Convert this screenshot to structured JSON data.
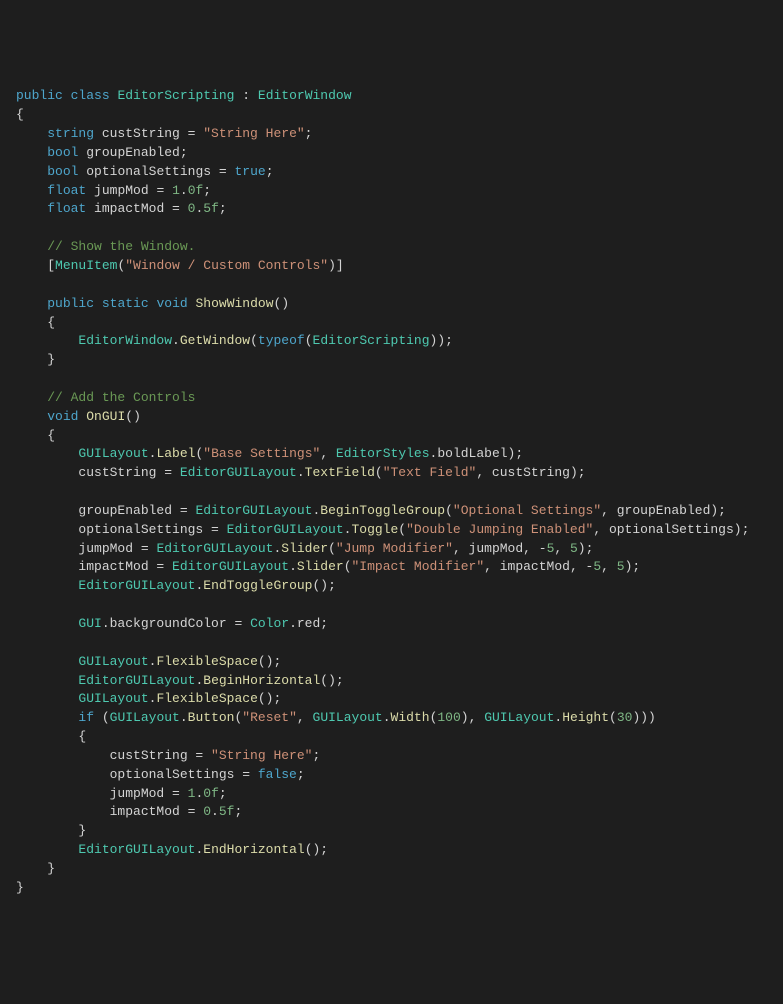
{
  "tokens": [
    [
      {
        "t": "public",
        "c": "kw"
      },
      {
        "t": " ",
        "c": "punct"
      },
      {
        "t": "class",
        "c": "kw"
      },
      {
        "t": " ",
        "c": "punct"
      },
      {
        "t": "EditorScripting",
        "c": "classname"
      },
      {
        "t": " : ",
        "c": "punct"
      },
      {
        "t": "EditorWindow",
        "c": "classname"
      }
    ],
    [
      {
        "t": "{",
        "c": "punct"
      }
    ],
    [
      {
        "t": "    ",
        "c": "punct"
      },
      {
        "t": "string",
        "c": "kw"
      },
      {
        "t": " custString = ",
        "c": "ident"
      },
      {
        "t": "\"String Here\"",
        "c": "str"
      },
      {
        "t": ";",
        "c": "punct"
      }
    ],
    [
      {
        "t": "    ",
        "c": "punct"
      },
      {
        "t": "bool",
        "c": "kw"
      },
      {
        "t": " groupEnabled;",
        "c": "ident"
      }
    ],
    [
      {
        "t": "    ",
        "c": "punct"
      },
      {
        "t": "bool",
        "c": "kw"
      },
      {
        "t": " optionalSettings = ",
        "c": "ident"
      },
      {
        "t": "true",
        "c": "kw"
      },
      {
        "t": ";",
        "c": "punct"
      }
    ],
    [
      {
        "t": "    ",
        "c": "punct"
      },
      {
        "t": "float",
        "c": "kw"
      },
      {
        "t": " jumpMod = ",
        "c": "ident"
      },
      {
        "t": "1",
        "c": "num"
      },
      {
        "t": ".",
        "c": "punct"
      },
      {
        "t": "0f",
        "c": "num"
      },
      {
        "t": ";",
        "c": "punct"
      }
    ],
    [
      {
        "t": "    ",
        "c": "punct"
      },
      {
        "t": "float",
        "c": "kw"
      },
      {
        "t": " impactMod = ",
        "c": "ident"
      },
      {
        "t": "0",
        "c": "num"
      },
      {
        "t": ".",
        "c": "punct"
      },
      {
        "t": "5f",
        "c": "num"
      },
      {
        "t": ";",
        "c": "punct"
      }
    ],
    [
      {
        "t": " ",
        "c": "punct"
      }
    ],
    [
      {
        "t": "    ",
        "c": "punct"
      },
      {
        "t": "// Show the Window.",
        "c": "comment"
      }
    ],
    [
      {
        "t": "    [",
        "c": "punct"
      },
      {
        "t": "MenuItem",
        "c": "attr"
      },
      {
        "t": "(",
        "c": "punct"
      },
      {
        "t": "\"Window / Custom Controls\"",
        "c": "str"
      },
      {
        "t": ")]",
        "c": "punct"
      }
    ],
    [
      {
        "t": " ",
        "c": "punct"
      }
    ],
    [
      {
        "t": "    ",
        "c": "punct"
      },
      {
        "t": "public",
        "c": "kw"
      },
      {
        "t": " ",
        "c": "punct"
      },
      {
        "t": "static",
        "c": "kw"
      },
      {
        "t": " ",
        "c": "punct"
      },
      {
        "t": "void",
        "c": "kw"
      },
      {
        "t": " ",
        "c": "punct"
      },
      {
        "t": "ShowWindow",
        "c": "method"
      },
      {
        "t": "()",
        "c": "punct"
      }
    ],
    [
      {
        "t": "    {",
        "c": "punct"
      }
    ],
    [
      {
        "t": "        ",
        "c": "punct"
      },
      {
        "t": "EditorWindow",
        "c": "classname"
      },
      {
        "t": ".",
        "c": "punct"
      },
      {
        "t": "GetWindow",
        "c": "method"
      },
      {
        "t": "(",
        "c": "punct"
      },
      {
        "t": "typeof",
        "c": "kw"
      },
      {
        "t": "(",
        "c": "punct"
      },
      {
        "t": "EditorScripting",
        "c": "classname"
      },
      {
        "t": "));",
        "c": "punct"
      }
    ],
    [
      {
        "t": "    }",
        "c": "punct"
      }
    ],
    [
      {
        "t": " ",
        "c": "punct"
      }
    ],
    [
      {
        "t": "    ",
        "c": "punct"
      },
      {
        "t": "// Add the Controls",
        "c": "comment"
      }
    ],
    [
      {
        "t": "    ",
        "c": "punct"
      },
      {
        "t": "void",
        "c": "kw"
      },
      {
        "t": " ",
        "c": "punct"
      },
      {
        "t": "OnGUI",
        "c": "method"
      },
      {
        "t": "()",
        "c": "punct"
      }
    ],
    [
      {
        "t": "    {",
        "c": "punct"
      }
    ],
    [
      {
        "t": "        ",
        "c": "punct"
      },
      {
        "t": "GUILayout",
        "c": "classname"
      },
      {
        "t": ".",
        "c": "punct"
      },
      {
        "t": "Label",
        "c": "method"
      },
      {
        "t": "(",
        "c": "punct"
      },
      {
        "t": "\"Base Settings\"",
        "c": "str"
      },
      {
        "t": ", ",
        "c": "punct"
      },
      {
        "t": "EditorStyles",
        "c": "classname"
      },
      {
        "t": ".boldLabel);",
        "c": "ident"
      }
    ],
    [
      {
        "t": "        custString = ",
        "c": "ident"
      },
      {
        "t": "EditorGUILayout",
        "c": "classname"
      },
      {
        "t": ".",
        "c": "punct"
      },
      {
        "t": "TextField",
        "c": "method"
      },
      {
        "t": "(",
        "c": "punct"
      },
      {
        "t": "\"Text Field\"",
        "c": "str"
      },
      {
        "t": ", custString);",
        "c": "ident"
      }
    ],
    [
      {
        "t": " ",
        "c": "punct"
      }
    ],
    [
      {
        "t": "        groupEnabled = ",
        "c": "ident"
      },
      {
        "t": "EditorGUILayout",
        "c": "classname"
      },
      {
        "t": ".",
        "c": "punct"
      },
      {
        "t": "BeginToggleGroup",
        "c": "method"
      },
      {
        "t": "(",
        "c": "punct"
      },
      {
        "t": "\"Optional Settings\"",
        "c": "str"
      },
      {
        "t": ", groupEnabled);",
        "c": "ident"
      }
    ],
    [
      {
        "t": "        optionalSettings = ",
        "c": "ident"
      },
      {
        "t": "EditorGUILayout",
        "c": "classname"
      },
      {
        "t": ".",
        "c": "punct"
      },
      {
        "t": "Toggle",
        "c": "method"
      },
      {
        "t": "(",
        "c": "punct"
      },
      {
        "t": "\"Double Jumping Enabled\"",
        "c": "str"
      },
      {
        "t": ", optionalSettings);",
        "c": "ident"
      }
    ],
    [
      {
        "t": "        jumpMod = ",
        "c": "ident"
      },
      {
        "t": "EditorGUILayout",
        "c": "classname"
      },
      {
        "t": ".",
        "c": "punct"
      },
      {
        "t": "Slider",
        "c": "method"
      },
      {
        "t": "(",
        "c": "punct"
      },
      {
        "t": "\"Jump Modifier\"",
        "c": "str"
      },
      {
        "t": ", jumpMod, -",
        "c": "ident"
      },
      {
        "t": "5",
        "c": "num"
      },
      {
        "t": ", ",
        "c": "punct"
      },
      {
        "t": "5",
        "c": "num"
      },
      {
        "t": ");",
        "c": "punct"
      }
    ],
    [
      {
        "t": "        impactMod = ",
        "c": "ident"
      },
      {
        "t": "EditorGUILayout",
        "c": "classname"
      },
      {
        "t": ".",
        "c": "punct"
      },
      {
        "t": "Slider",
        "c": "method"
      },
      {
        "t": "(",
        "c": "punct"
      },
      {
        "t": "\"Impact Modifier\"",
        "c": "str"
      },
      {
        "t": ", impactMod, -",
        "c": "ident"
      },
      {
        "t": "5",
        "c": "num"
      },
      {
        "t": ", ",
        "c": "punct"
      },
      {
        "t": "5",
        "c": "num"
      },
      {
        "t": ");",
        "c": "punct"
      }
    ],
    [
      {
        "t": "        ",
        "c": "punct"
      },
      {
        "t": "EditorGUILayout",
        "c": "classname"
      },
      {
        "t": ".",
        "c": "punct"
      },
      {
        "t": "EndToggleGroup",
        "c": "method"
      },
      {
        "t": "();",
        "c": "punct"
      }
    ],
    [
      {
        "t": " ",
        "c": "punct"
      }
    ],
    [
      {
        "t": "        ",
        "c": "punct"
      },
      {
        "t": "GUI",
        "c": "classname"
      },
      {
        "t": ".backgroundColor = ",
        "c": "ident"
      },
      {
        "t": "Color",
        "c": "classname"
      },
      {
        "t": ".red;",
        "c": "ident"
      }
    ],
    [
      {
        "t": " ",
        "c": "punct"
      }
    ],
    [
      {
        "t": "        ",
        "c": "punct"
      },
      {
        "t": "GUILayout",
        "c": "classname"
      },
      {
        "t": ".",
        "c": "punct"
      },
      {
        "t": "FlexibleSpace",
        "c": "method"
      },
      {
        "t": "();",
        "c": "punct"
      }
    ],
    [
      {
        "t": "        ",
        "c": "punct"
      },
      {
        "t": "EditorGUILayout",
        "c": "classname"
      },
      {
        "t": ".",
        "c": "punct"
      },
      {
        "t": "BeginHorizontal",
        "c": "method"
      },
      {
        "t": "();",
        "c": "punct"
      }
    ],
    [
      {
        "t": "        ",
        "c": "punct"
      },
      {
        "t": "GUILayout",
        "c": "classname"
      },
      {
        "t": ".",
        "c": "punct"
      },
      {
        "t": "FlexibleSpace",
        "c": "method"
      },
      {
        "t": "();",
        "c": "punct"
      }
    ],
    [
      {
        "t": "        ",
        "c": "punct"
      },
      {
        "t": "if",
        "c": "kw"
      },
      {
        "t": " (",
        "c": "punct"
      },
      {
        "t": "GUILayout",
        "c": "classname"
      },
      {
        "t": ".",
        "c": "punct"
      },
      {
        "t": "Button",
        "c": "method"
      },
      {
        "t": "(",
        "c": "punct"
      },
      {
        "t": "\"Reset\"",
        "c": "str"
      },
      {
        "t": ", ",
        "c": "punct"
      },
      {
        "t": "GUILayout",
        "c": "classname"
      },
      {
        "t": ".",
        "c": "punct"
      },
      {
        "t": "Width",
        "c": "method"
      },
      {
        "t": "(",
        "c": "punct"
      },
      {
        "t": "100",
        "c": "num"
      },
      {
        "t": "), ",
        "c": "punct"
      },
      {
        "t": "GUILayout",
        "c": "classname"
      },
      {
        "t": ".",
        "c": "punct"
      },
      {
        "t": "Height",
        "c": "method"
      },
      {
        "t": "(",
        "c": "punct"
      },
      {
        "t": "30",
        "c": "num"
      },
      {
        "t": ")))",
        "c": "punct"
      }
    ],
    [
      {
        "t": "        {",
        "c": "punct"
      }
    ],
    [
      {
        "t": "            custString = ",
        "c": "ident"
      },
      {
        "t": "\"String Here\"",
        "c": "str"
      },
      {
        "t": ";",
        "c": "punct"
      }
    ],
    [
      {
        "t": "            optionalSettings = ",
        "c": "ident"
      },
      {
        "t": "false",
        "c": "kw"
      },
      {
        "t": ";",
        "c": "punct"
      }
    ],
    [
      {
        "t": "            jumpMod = ",
        "c": "ident"
      },
      {
        "t": "1",
        "c": "num"
      },
      {
        "t": ".",
        "c": "punct"
      },
      {
        "t": "0f",
        "c": "num"
      },
      {
        "t": ";",
        "c": "punct"
      }
    ],
    [
      {
        "t": "            impactMod = ",
        "c": "ident"
      },
      {
        "t": "0",
        "c": "num"
      },
      {
        "t": ".",
        "c": "punct"
      },
      {
        "t": "5f",
        "c": "num"
      },
      {
        "t": ";",
        "c": "punct"
      }
    ],
    [
      {
        "t": "        }",
        "c": "punct"
      }
    ],
    [
      {
        "t": "        ",
        "c": "punct"
      },
      {
        "t": "EditorGUILayout",
        "c": "classname"
      },
      {
        "t": ".",
        "c": "punct"
      },
      {
        "t": "EndHorizontal",
        "c": "method"
      },
      {
        "t": "();",
        "c": "punct"
      }
    ],
    [
      {
        "t": "    }",
        "c": "punct"
      }
    ],
    [
      {
        "t": "}",
        "c": "punct"
      }
    ]
  ]
}
